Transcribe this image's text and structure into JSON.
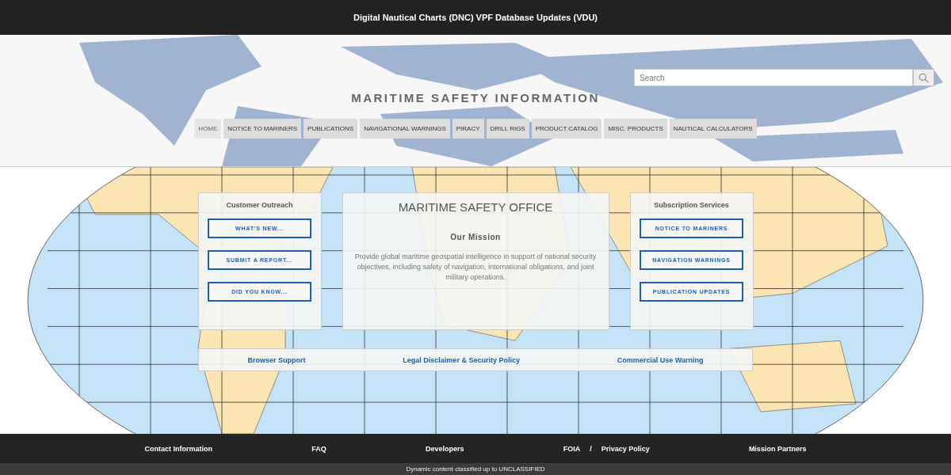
{
  "top_bar": {
    "title": "Digital Nautical Charts (DNC) VPF Database Updates (VDU)"
  },
  "banner": {
    "search": {
      "placeholder": "Search"
    },
    "site_title": "MARITIME SAFETY INFORMATION",
    "nav": [
      {
        "label": "HOME",
        "selected": true
      },
      {
        "label": "NOTICE TO MARINERS",
        "selected": false
      },
      {
        "label": "PUBLICATIONS",
        "selected": false
      },
      {
        "label": "NAVIGATIONAL WARNINGS",
        "selected": false
      },
      {
        "label": "PIRACY",
        "selected": false
      },
      {
        "label": "DRILL RIGS",
        "selected": false
      },
      {
        "label": "PRODUCT CATALOG",
        "selected": false
      },
      {
        "label": "MISC. PRODUCTS",
        "selected": false
      },
      {
        "label": "NAUTICAL CALCULATORS",
        "selected": false
      }
    ]
  },
  "customer_outreach": {
    "title": "Customer Outreach",
    "buttons": [
      "WHAT'S NEW...",
      "SUBMIT A REPORT...",
      "DID YOU KNOW..."
    ]
  },
  "office": {
    "title": "MARITIME SAFETY OFFICE",
    "subtitle": "Our Mission",
    "text": "Provide global maritime geospatial intelligence in support of national security objectives, including safety of navigation, international obligations, and joint military operations."
  },
  "subscription_services": {
    "title": "Subscription Services",
    "buttons": [
      "NOTICE TO MARINERS",
      "NAVIGATION WARNINGS",
      "PUBLICATION UPDATES"
    ]
  },
  "links": [
    "Browser Support",
    "Legal Disclaimer & Security Policy",
    "Commercial Use Warning"
  ],
  "footer": {
    "links": [
      "Contact Information",
      "FAQ",
      "Developers"
    ],
    "foia": "FOIA",
    "separator": "/",
    "privacy": "Privacy Policy",
    "partners": "Mission Partners",
    "classification": "Dynamic content classified up to UNCLASSIFIED"
  }
}
